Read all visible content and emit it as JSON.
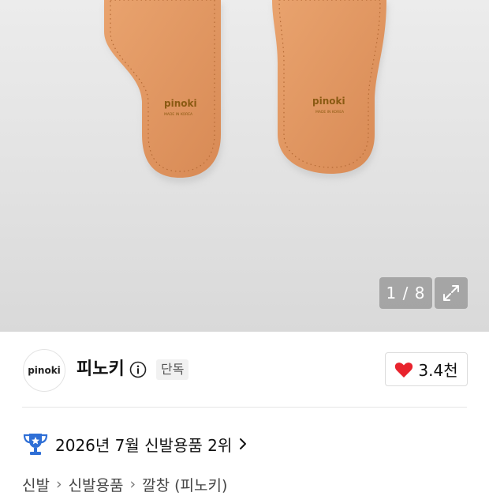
{
  "gallery": {
    "counter": "1 / 8",
    "insole_brand_text": "pinoki",
    "insole_sub_text": "MADE IN KOREA"
  },
  "brand": {
    "logo_text": "pinoki",
    "name": "피노키",
    "badge": "단독",
    "likes": "3.4천",
    "like_color": "#e8232d"
  },
  "ranking": {
    "text": "2026년 7월 신발용품 2위",
    "trophy_color": "#2f6fd6"
  },
  "breadcrumb": {
    "items": [
      "신발",
      "신발용품",
      "깔창 (피노키)"
    ]
  }
}
